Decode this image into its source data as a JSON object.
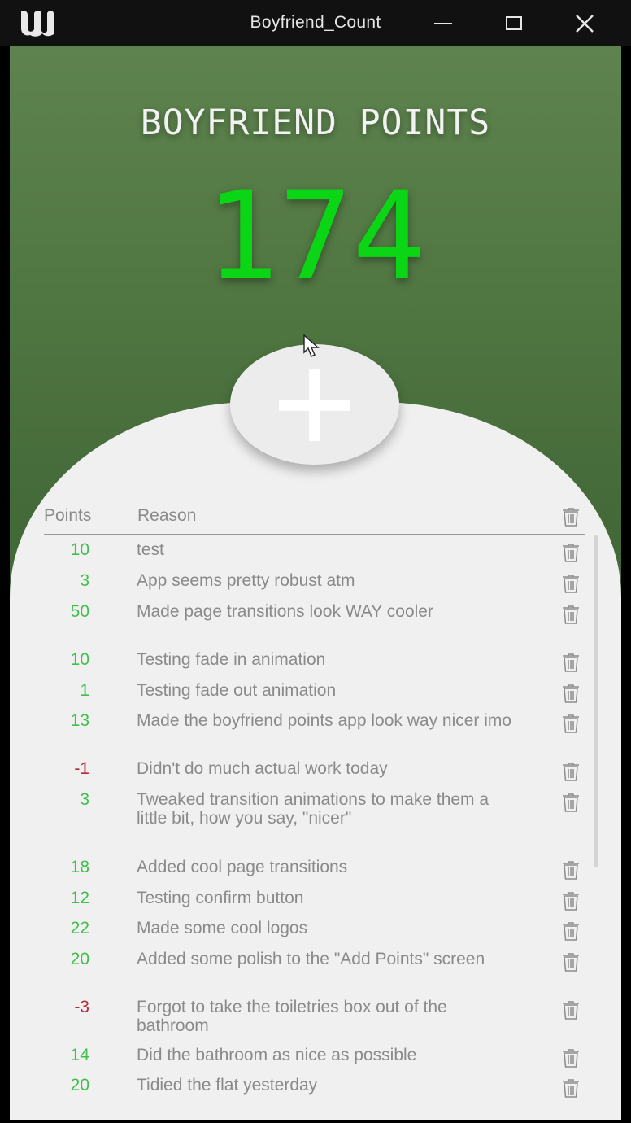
{
  "window": {
    "title": "Boyfriend_Count",
    "logo": "unreal-engine-logo"
  },
  "app": {
    "heading": "BOYFRIEND POINTS",
    "score": "174",
    "add_button_icon": "plus-icon"
  },
  "table": {
    "headers": {
      "points": "Points",
      "reason": "Reason"
    },
    "rows": [
      {
        "points": "10",
        "reason": "test",
        "status": "positive"
      },
      {
        "points": "3",
        "reason": "App seems pretty robust atm",
        "status": "positive"
      },
      {
        "points": "50",
        "reason": "Made page transitions look WAY cooler",
        "status": "positive"
      },
      {
        "points": "10",
        "reason": "Testing fade in animation",
        "status": "positive"
      },
      {
        "points": "1",
        "reason": "Testing fade out animation",
        "status": "positive"
      },
      {
        "points": "13",
        "reason": "Made the boyfriend points app look way nicer imo",
        "status": "positive"
      },
      {
        "points": "-1",
        "reason": "Didn't do much actual work today",
        "status": "negative"
      },
      {
        "points": "3",
        "reason": "Tweaked transition animations to make them a little bit, how you say, \"nicer\"",
        "status": "positive"
      },
      {
        "points": "18",
        "reason": "Added cool page transitions",
        "status": "positive"
      },
      {
        "points": "12",
        "reason": "Testing confirm button",
        "status": "positive"
      },
      {
        "points": "22",
        "reason": "Made some cool logos",
        "status": "positive"
      },
      {
        "points": "20",
        "reason": "Added some polish to the \"Add Points\" screen",
        "status": "positive"
      },
      {
        "points": "-3",
        "reason": "Forgot to take the toiletries box out of the bathroom",
        "status": "negative"
      },
      {
        "points": "14",
        "reason": "Did the bathroom as nice as possible",
        "status": "positive"
      },
      {
        "points": "20",
        "reason": "Tidied the flat yesterday",
        "status": "positive"
      }
    ]
  },
  "colors": {
    "score": "#0bd616",
    "positive": "#3fc04a",
    "negative": "#b32a3c",
    "panel": "#f0f0f0",
    "background_top": "#5e834e",
    "background_bottom": "#3f6235"
  }
}
